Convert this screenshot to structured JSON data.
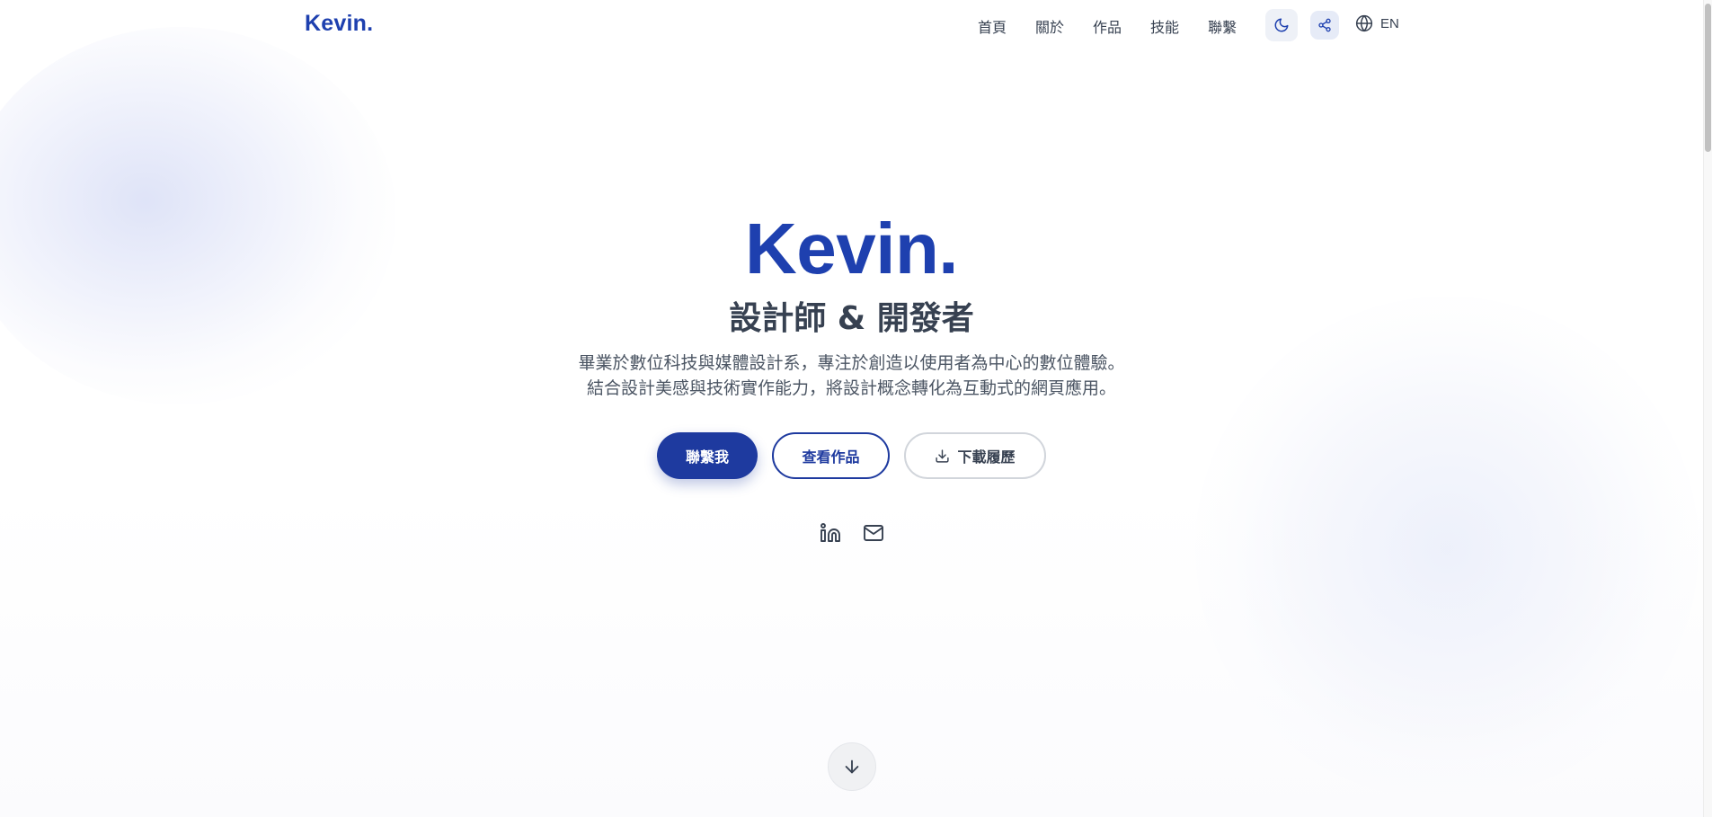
{
  "header": {
    "brand": "Kevin.",
    "nav": [
      {
        "label": "首頁"
      },
      {
        "label": "關於"
      },
      {
        "label": "作品"
      },
      {
        "label": "技能"
      },
      {
        "label": "聯繫"
      }
    ],
    "theme_icon": "moon-icon",
    "share_icon": "share-icon",
    "language_icon": "globe-icon",
    "language_label": "EN"
  },
  "hero": {
    "title": "Kevin.",
    "subtitle": "設計師 & 開發者",
    "description_lines": [
      "畢業於數位科技與媒體設計系，專注於創造以使用者為中心的數位體驗。",
      "結合設計美感與技術實作能力，將設計概念轉化為互動式的網頁應用。"
    ],
    "buttons": {
      "contact": "聯繫我",
      "works": "查看作品",
      "resume": "下載履歷"
    },
    "resume_icon": "download-icon",
    "social": [
      {
        "icon": "linkedin-icon"
      },
      {
        "icon": "mail-icon"
      }
    ],
    "scroll_icon": "arrow-down-icon"
  },
  "colors": {
    "accent": "#1e40af",
    "primary_button": "#1e3a9f",
    "text": "#374151"
  }
}
